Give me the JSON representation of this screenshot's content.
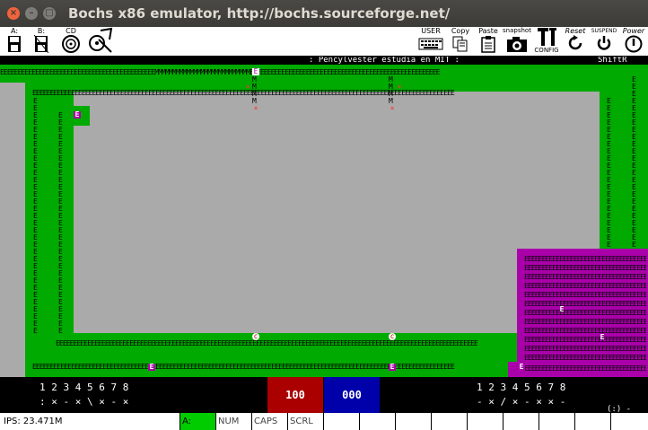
{
  "window": {
    "title": "Bochs x86 emulator, http://bochs.sourceforge.net/",
    "close_glyph": "×",
    "min_glyph": "–",
    "max_glyph": "□"
  },
  "toolbar": {
    "floppy_a": "A:",
    "floppy_b": "B:",
    "cdrom": "CD",
    "user": "USER",
    "copy": "Copy",
    "paste": "Paste",
    "snapshot": "snapshot",
    "config": "CONFIG",
    "reset": "Reset",
    "suspend": "SUSPEND",
    "power": "Power"
  },
  "screen": {
    "status_message": ": Pencylvester estudia en MIT :",
    "status_right": "ShiftR",
    "top_row": "EEEEEEEEEEEEEEEEEEEEEEEEEEEEEEEEEEEEEEEEEEEEMMMMMMMMMMMMMMMMMMMMMMMMMMMEEEEEEEEEEEEEEEEEEEEEEEEEEEEEEEEEEEEEEEEEEEEEEEEEEEEEE",
    "row_e": "EEEEEEEEEEEEEEEEEEEEEEEEEEEEEEEEEEEEEEEEEEEEEEEEEEEEEEEEEEEEEEEEEEEEEEEEEEEEEEEEEEEEEEEEEEEEEEEEEEEEEEEEEEEEEEEEEEEEEEEE",
    "col_e": "E",
    "col_m": "M",
    "marker_e": "E",
    "marker_c": "c",
    "marker_x": "×"
  },
  "panel": {
    "left_numbers": "1 2 3 4 5 6 7 8",
    "left_marks": ": × - × \\ × - ×",
    "right_numbers": "1 2 3 4 5 6 7 8",
    "right_marks": "- × / × - × × -",
    "score_red": "100",
    "score_blue": "000",
    "right_extra": "(:) -"
  },
  "statusbar": {
    "ips": "IPS: 23.471M",
    "drive": "A:",
    "num": "NUM",
    "caps": "CAPS",
    "scrl": "SCRL"
  },
  "colors": {
    "field_green": "#00aa00",
    "field_purple": "#aa00aa",
    "screen_gray": "#aaaaaa",
    "score_red": "#aa0000",
    "score_blue": "#0000aa",
    "led_green": "#00cc00"
  }
}
